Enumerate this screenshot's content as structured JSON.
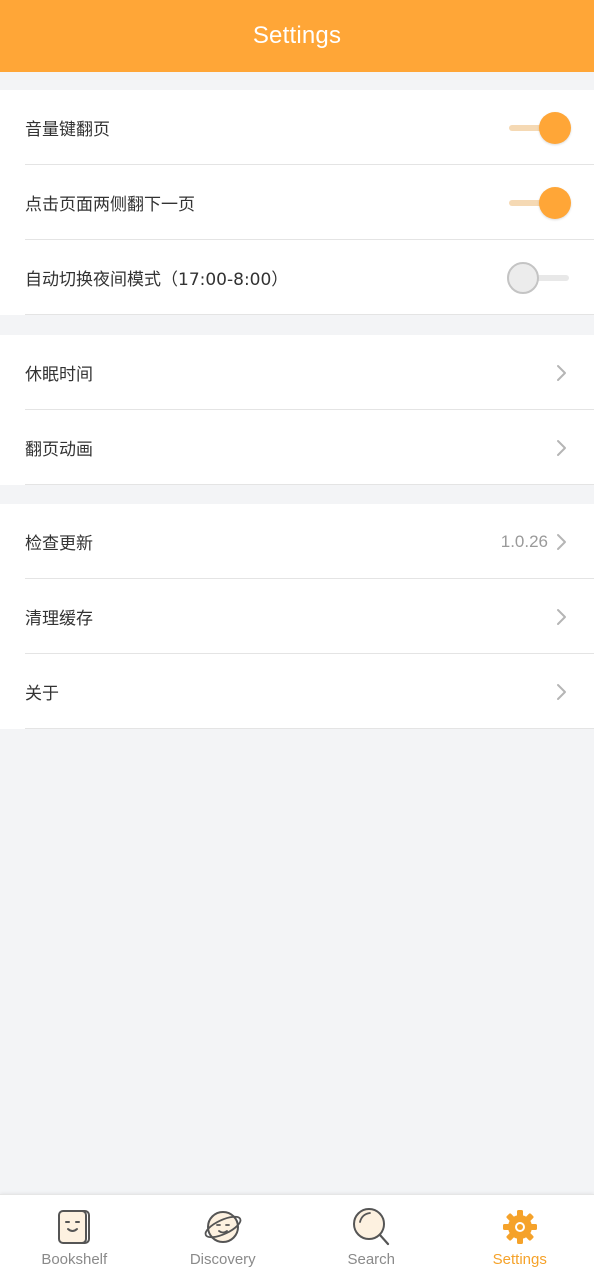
{
  "header": {
    "title": "Settings"
  },
  "colors": {
    "accent": "#ffa637",
    "background": "#f3f4f6"
  },
  "group1": {
    "items": [
      {
        "label": "音量键翻页",
        "toggle": true
      },
      {
        "label": "点击页面两侧翻下一页",
        "toggle": true
      },
      {
        "label": "自动切换夜间模式（17:00-8:00）",
        "toggle": false
      }
    ]
  },
  "group2": {
    "items": [
      {
        "label": "休眠时间"
      },
      {
        "label": "翻页动画"
      }
    ]
  },
  "group3": {
    "items": [
      {
        "label": "检查更新",
        "value": "1.0.26"
      },
      {
        "label": "清理缓存"
      },
      {
        "label": "关于"
      }
    ]
  },
  "bottom_nav": {
    "items": [
      {
        "label": "Bookshelf",
        "icon": "bookshelf-icon",
        "active": false
      },
      {
        "label": "Discovery",
        "icon": "planet-icon",
        "active": false
      },
      {
        "label": "Search",
        "icon": "search-icon",
        "active": false
      },
      {
        "label": "Settings",
        "icon": "gear-icon",
        "active": true
      }
    ]
  }
}
